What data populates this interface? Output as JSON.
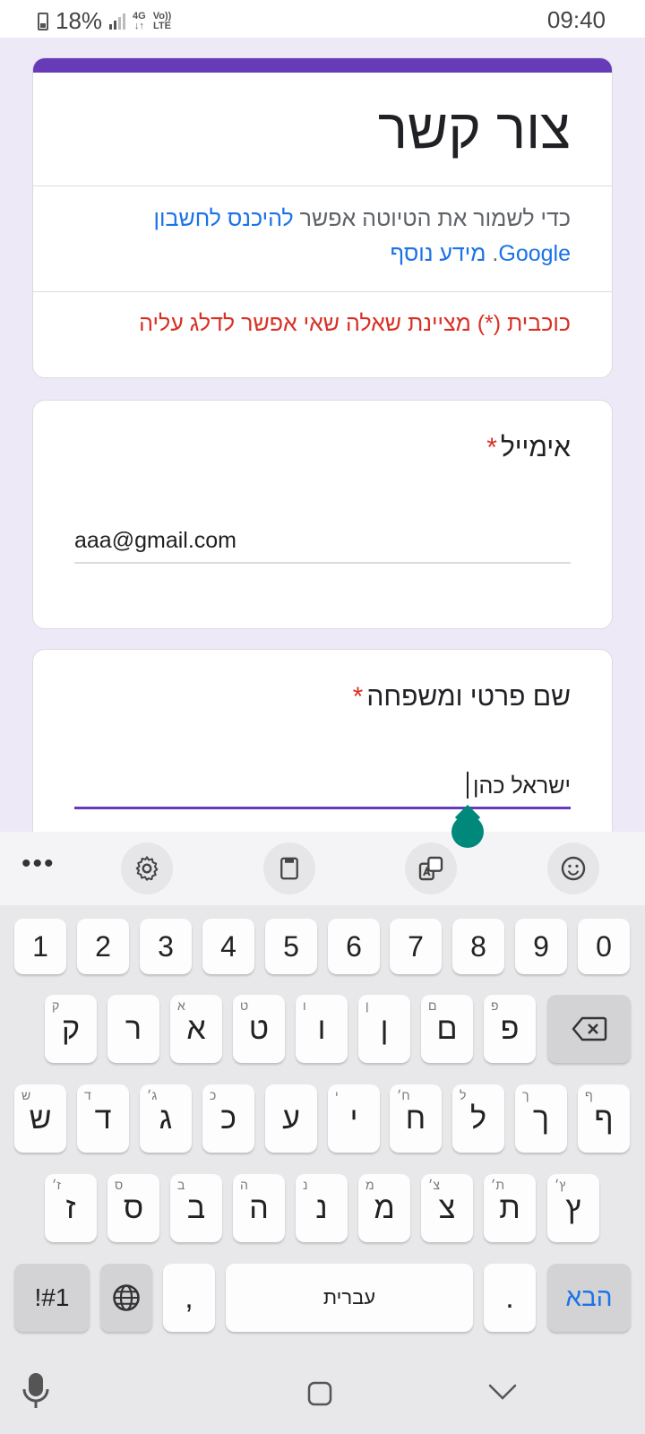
{
  "status_bar": {
    "battery": "18%",
    "network_top": "4G",
    "volte_top": "Vo))",
    "volte_bottom": "LTE",
    "time": "09:40"
  },
  "header_card": {
    "title": "צור קשר",
    "info_text_prefix": "כדי לשמור את הטיוטה אפשר ",
    "info_link_login": "להיכנס לחשבון Google",
    "info_text_mid": ". ",
    "info_link_more": "מידע נוסף",
    "required_note": "כוכבית (*) מציינת שאלה שאי אפשר לדלג עליה"
  },
  "questions": [
    {
      "title": "אימייל",
      "required_mark": "*",
      "value": "aaa@gmail.com"
    },
    {
      "title": "שם פרטי ומשפחה",
      "required_mark": "*",
      "value": "ישראל כהן"
    }
  ],
  "keyboard": {
    "toolbar": {
      "more": "•••"
    },
    "number_row": [
      "1",
      "2",
      "3",
      "4",
      "5",
      "6",
      "7",
      "8",
      "9",
      "0"
    ],
    "row1": [
      {
        "key": "ק",
        "hint": "ק"
      },
      {
        "key": "ר",
        "hint": ""
      },
      {
        "key": "א",
        "hint": "א"
      },
      {
        "key": "ט",
        "hint": "ט"
      },
      {
        "key": "ו",
        "hint": "ו"
      },
      {
        "key": "ן",
        "hint": "ן"
      },
      {
        "key": "ם",
        "hint": "ם"
      },
      {
        "key": "פ",
        "hint": "פ"
      }
    ],
    "row2": [
      {
        "key": "ש",
        "hint": "ש"
      },
      {
        "key": "ד",
        "hint": "ד"
      },
      {
        "key": "ג",
        "hint": "ג׳"
      },
      {
        "key": "כ",
        "hint": "כ"
      },
      {
        "key": "ע",
        "hint": ""
      },
      {
        "key": "י",
        "hint": "י"
      },
      {
        "key": "ח",
        "hint": "ח׳"
      },
      {
        "key": "ל",
        "hint": "ל"
      },
      {
        "key": "ך",
        "hint": "ך"
      },
      {
        "key": "ף",
        "hint": "ף"
      }
    ],
    "row3": [
      {
        "key": "ז",
        "hint": "ז׳"
      },
      {
        "key": "ס",
        "hint": "ס"
      },
      {
        "key": "ב",
        "hint": "ב"
      },
      {
        "key": "ה",
        "hint": "ה"
      },
      {
        "key": "נ",
        "hint": "נ"
      },
      {
        "key": "מ",
        "hint": "מ"
      },
      {
        "key": "צ",
        "hint": "צ׳"
      },
      {
        "key": "ת",
        "hint": "ת׳"
      },
      {
        "key": "ץ",
        "hint": "ץ׳"
      }
    ],
    "symbols_label": "!#1",
    "comma": ",",
    "space_label": "עברית",
    "period": ".",
    "next_label": "הבא"
  },
  "colors": {
    "accent": "#673ab7",
    "link": "#1a73e8",
    "error": "#d93025",
    "handle": "#00897b"
  }
}
